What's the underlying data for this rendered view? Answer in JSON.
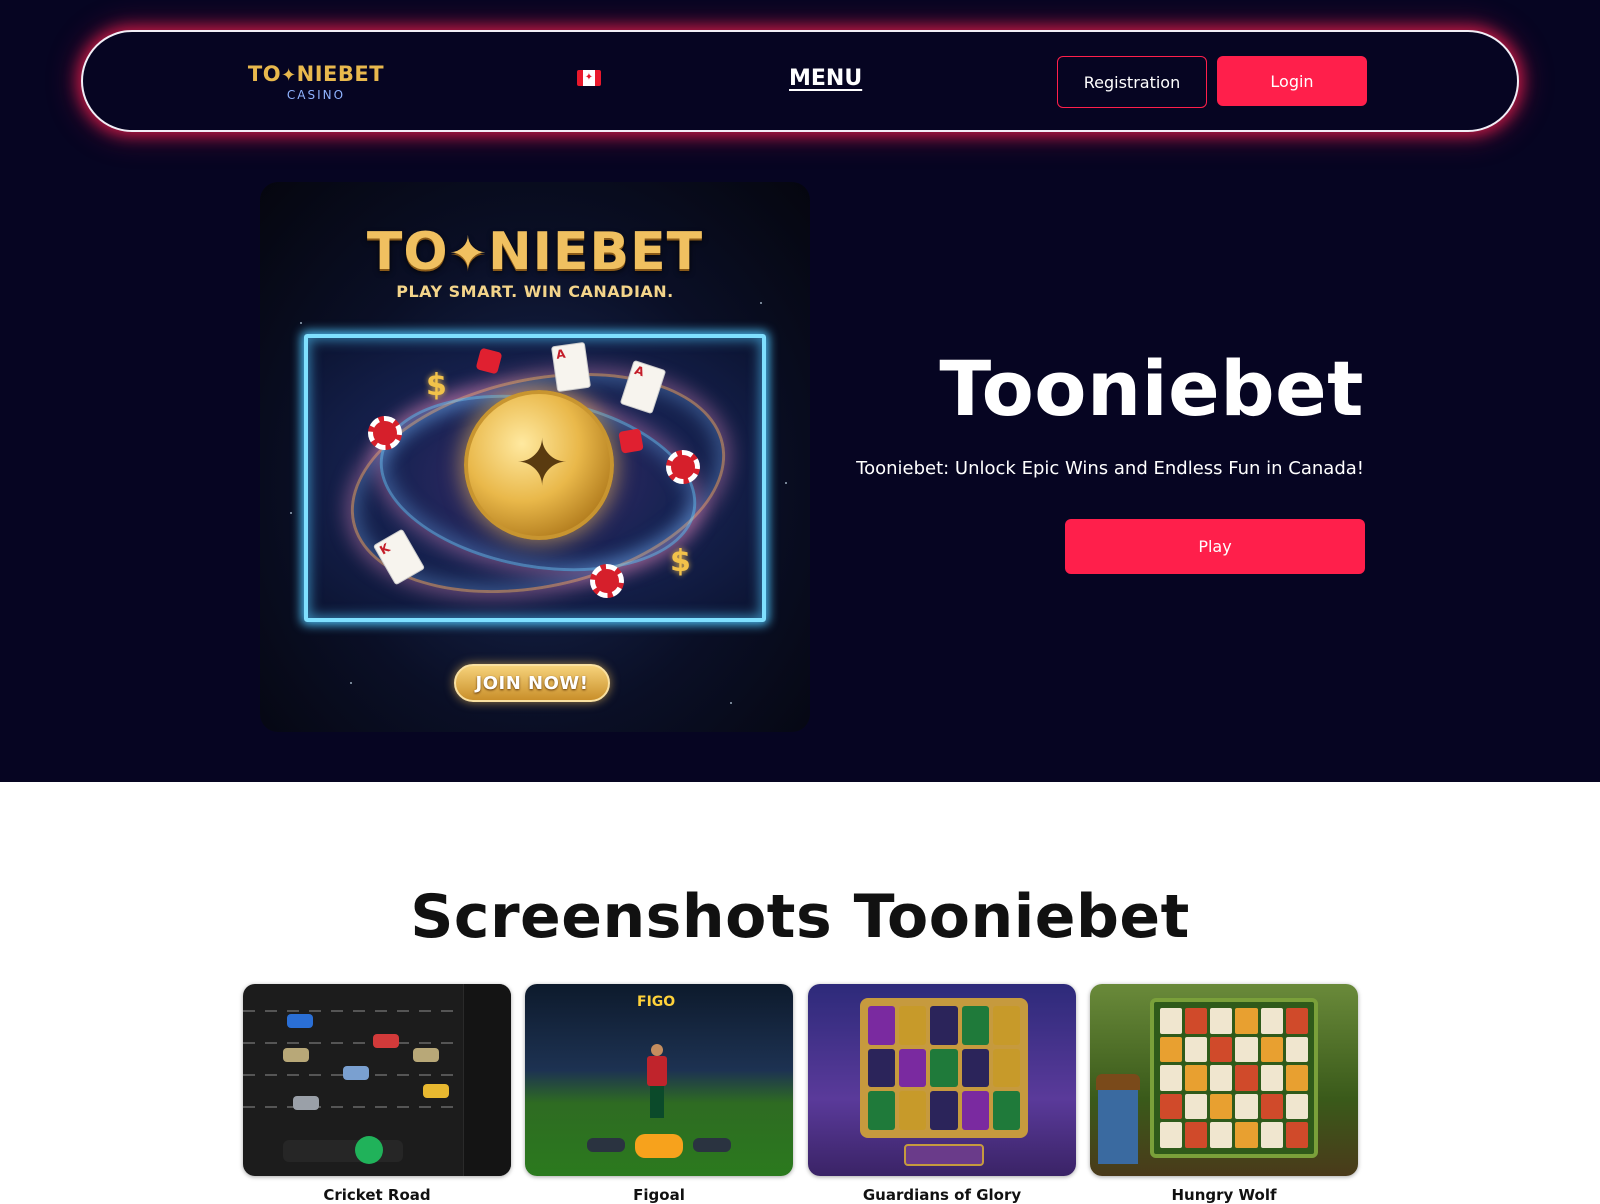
{
  "header": {
    "logo_text": "TO❤NIEBET",
    "logo_main_prefix": "TO",
    "logo_main_suffix": "NIEBET",
    "logo_sub": "CASINO",
    "flag_icon": "canada-flag-icon",
    "menu_label": "MENU",
    "registration_label": "Registration",
    "login_label": "Login"
  },
  "banner": {
    "title_prefix": "TO",
    "title_suffix": "NIEBET",
    "tagline": "PLAY SMART. WIN CANADIAN.",
    "join_label": "JOIN NOW!"
  },
  "hero": {
    "title": "Tooniebet",
    "subtitle": "Tooniebet: Unlock Epic Wins and Endless Fun in Canada!",
    "play_label": "Play"
  },
  "screenshots": {
    "title": "Screenshots Tooniebet",
    "items": [
      {
        "label": "Cricket Road"
      },
      {
        "label": "Figoal"
      },
      {
        "label": "Guardians of Glory"
      },
      {
        "label": "Hungry Wolf"
      }
    ]
  },
  "colors": {
    "background_dark": "#060522",
    "accent": "#ff1f4b",
    "gold": "#e8b84d"
  }
}
